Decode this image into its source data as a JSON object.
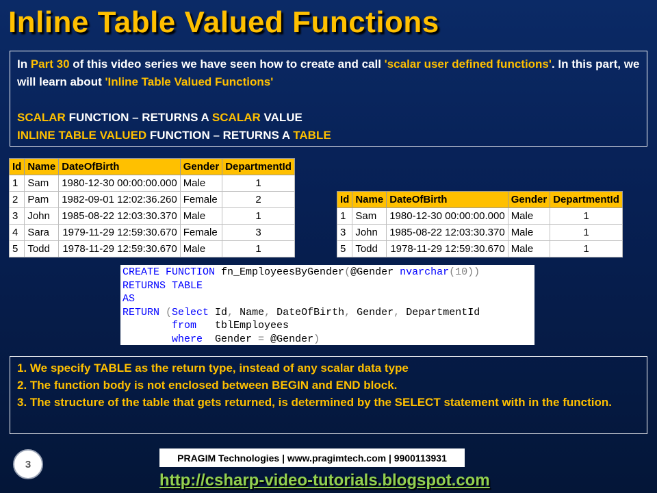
{
  "title": "Inline Table Valued Functions",
  "intro": {
    "p1_a": "In ",
    "p1_part": "Part 30",
    "p1_b": " of this video series we have seen how to create and call ",
    "p1_scalar": "'scalar user defined functions'",
    "p1_c": ". In this part, we will learn about ",
    "p1_inline": "'Inline Table Valued Functions'",
    "p1_d": "",
    "line2_a": "SCALAR",
    "line2_b": " FUNCTION – RETURNS A ",
    "line2_c": "SCALAR",
    "line2_d": " VALUE",
    "line3_a": "INLINE TABLE VALUED",
    "line3_b": " FUNCTION – RETURNS A ",
    "line3_c": "TABLE"
  },
  "table_all": {
    "headers": [
      "Id",
      "Name",
      "DateOfBirth",
      "Gender",
      "DepartmentId"
    ],
    "rows": [
      [
        "1",
        "Sam",
        "1980-12-30 00:00:00.000",
        "Male",
        "1"
      ],
      [
        "2",
        "Pam",
        "1982-09-01 12:02:36.260",
        "Female",
        "2"
      ],
      [
        "3",
        "John",
        "1985-08-22 12:03:30.370",
        "Male",
        "1"
      ],
      [
        "4",
        "Sara",
        "1979-11-29 12:59:30.670",
        "Female",
        "3"
      ],
      [
        "5",
        "Todd",
        "1978-11-29 12:59:30.670",
        "Male",
        "1"
      ]
    ]
  },
  "table_male": {
    "headers": [
      "Id",
      "Name",
      "DateOfBirth",
      "Gender",
      "DepartmentId"
    ],
    "rows": [
      [
        "1",
        "Sam",
        "1980-12-30 00:00:00.000",
        "Male",
        "1"
      ],
      [
        "3",
        "John",
        "1985-08-22 12:03:30.370",
        "Male",
        "1"
      ],
      [
        "5",
        "Todd",
        "1978-11-29 12:59:30.670",
        "Male",
        "1"
      ]
    ]
  },
  "code": {
    "l1_kw": "CREATE FUNCTION",
    "l1_rest": " fn_EmployeesByGender",
    "l1_p1": "(",
    "l1_param": "@Gender ",
    "l1_type": "nvarchar",
    "l1_p2": "(10))",
    "l2": "RETURNS TABLE",
    "l3": "AS",
    "l4_kw": "RETURN",
    "l4_p": " (",
    "l4_sel": "Select",
    "l4_rest": " Id",
    "l4_c1": ",",
    "l4_r2": " Name",
    "l4_c2": ",",
    "l4_r3": " DateOfBirth",
    "l4_c3": ",",
    "l4_r4": " Gender",
    "l4_c4": ",",
    "l4_r5": " DepartmentId",
    "l5_kw": "from",
    "l5_rest": "   tblEmployees",
    "l6_kw": "where",
    "l6_rest": "  Gender ",
    "l6_eq": "=",
    "l6_param": " @Gender",
    "l6_close": ")"
  },
  "notes": [
    "1. We specify TABLE as the return type, instead of any scalar data type",
    "2. The function body is not enclosed between BEGIN and END block.",
    "3. The structure of the table that gets returned, is determined by the SELECT statement with in the function."
  ],
  "page_number": "3",
  "footer_brand": "PRAGIM Technologies | www.pragimtech.com | 9900113931",
  "footer_link": "http://csharp-video-tutorials.blogspot.com"
}
